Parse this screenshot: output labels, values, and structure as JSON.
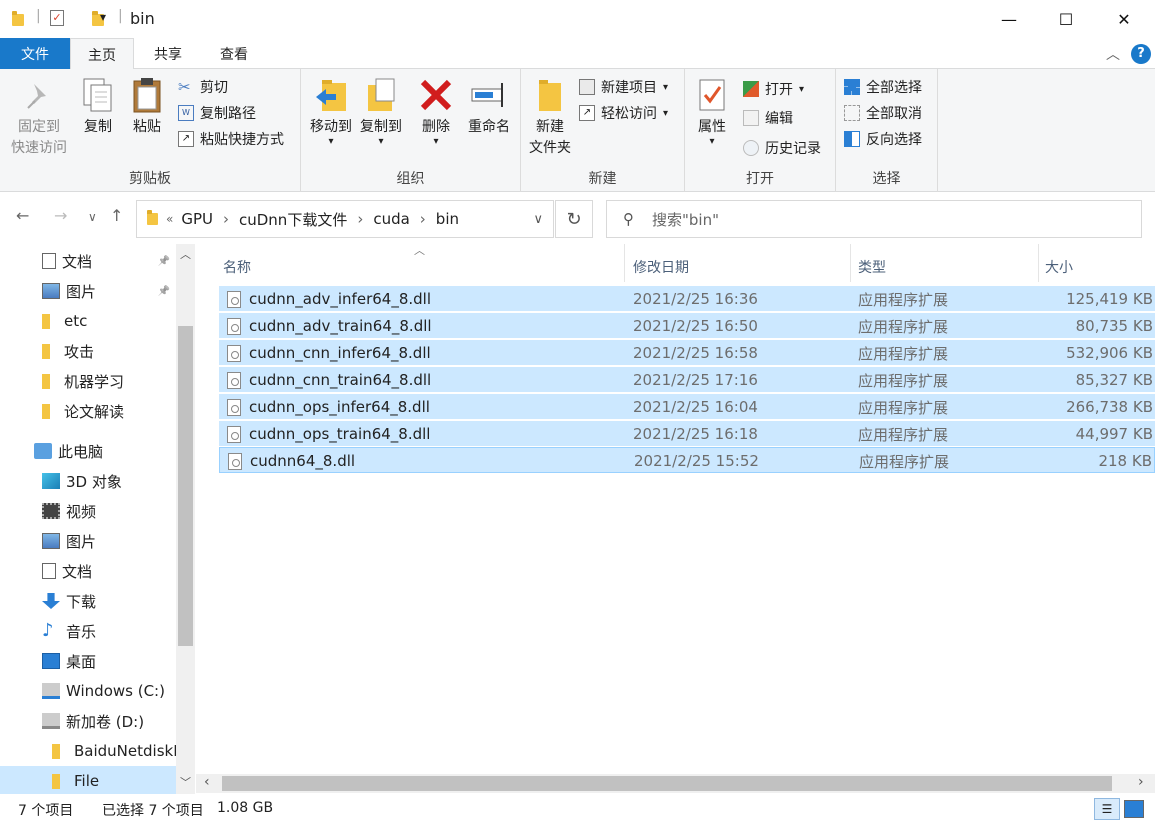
{
  "window": {
    "title": "bin",
    "controls": {
      "minimize": "—",
      "maximize": "☐",
      "close": "✕"
    }
  },
  "ribbon_tabs": {
    "file": "文件",
    "home": "主页",
    "share": "共享",
    "view": "查看"
  },
  "ribbon": {
    "clipboard": {
      "label": "剪贴板",
      "pin_line1": "固定到",
      "pin_line2": "快速访问",
      "copy": "复制",
      "paste": "粘贴",
      "cut": "剪切",
      "copy_path": "复制路径",
      "paste_shortcut": "粘贴快捷方式"
    },
    "organize": {
      "label": "组织",
      "move_to": "移动到",
      "copy_to": "复制到",
      "delete": "删除",
      "rename": "重命名"
    },
    "new": {
      "label": "新建",
      "new_folder_line1": "新建",
      "new_folder_line2": "文件夹",
      "new_item": "新建项目",
      "easy_access": "轻松访问"
    },
    "open": {
      "label": "打开",
      "properties": "属性",
      "open": "打开",
      "edit": "编辑",
      "history": "历史记录"
    },
    "select": {
      "label": "选择",
      "select_all": "全部选择",
      "select_none": "全部取消",
      "invert": "反向选择"
    }
  },
  "address": {
    "breadcrumb": [
      "GPU",
      "cuDnn下载文件",
      "cuda",
      "bin"
    ],
    "search_placeholder": "搜索\"bin\""
  },
  "nav_pane": {
    "items": [
      {
        "label": "文档",
        "icon": "documents-icon"
      },
      {
        "label": "图片",
        "icon": "pictures-icon"
      },
      {
        "label": "etc",
        "icon": "folder-icon"
      },
      {
        "label": "攻击",
        "icon": "folder-icon"
      },
      {
        "label": "机器学习",
        "icon": "folder-icon"
      },
      {
        "label": "论文解读",
        "icon": "folder-icon"
      },
      {
        "label": "此电脑",
        "icon": "this-pc-icon"
      },
      {
        "label": "3D 对象",
        "icon": "3d-objects-icon"
      },
      {
        "label": "视频",
        "icon": "videos-icon"
      },
      {
        "label": "图片",
        "icon": "pictures-icon"
      },
      {
        "label": "文档",
        "icon": "documents-icon"
      },
      {
        "label": "下载",
        "icon": "downloads-icon"
      },
      {
        "label": "音乐",
        "icon": "music-icon"
      },
      {
        "label": "桌面",
        "icon": "desktop-icon"
      },
      {
        "label": "Windows (C:)",
        "icon": "windows-drive-icon"
      },
      {
        "label": "新加卷 (D:)",
        "icon": "drive-icon"
      },
      {
        "label": "BaiduNetdiskI",
        "icon": "folder-icon"
      },
      {
        "label": "File",
        "icon": "folder-icon"
      }
    ]
  },
  "columns": {
    "name": "名称",
    "date": "修改日期",
    "type": "类型",
    "size": "大小"
  },
  "files": [
    {
      "name": "cudnn_adv_infer64_8.dll",
      "date": "2021/2/25 16:36",
      "type": "应用程序扩展",
      "size": "125,419 KB"
    },
    {
      "name": "cudnn_adv_train64_8.dll",
      "date": "2021/2/25 16:50",
      "type": "应用程序扩展",
      "size": "80,735 KB"
    },
    {
      "name": "cudnn_cnn_infer64_8.dll",
      "date": "2021/2/25 16:58",
      "type": "应用程序扩展",
      "size": "532,906 KB"
    },
    {
      "name": "cudnn_cnn_train64_8.dll",
      "date": "2021/2/25 17:16",
      "type": "应用程序扩展",
      "size": "85,327 KB"
    },
    {
      "name": "cudnn_ops_infer64_8.dll",
      "date": "2021/2/25 16:04",
      "type": "应用程序扩展",
      "size": "266,738 KB"
    },
    {
      "name": "cudnn_ops_train64_8.dll",
      "date": "2021/2/25 16:18",
      "type": "应用程序扩展",
      "size": "44,997 KB"
    },
    {
      "name": "cudnn64_8.dll",
      "date": "2021/2/25 15:52",
      "type": "应用程序扩展",
      "size": "218 KB"
    }
  ],
  "status": {
    "count": "7 个项目",
    "selected": "已选择 7 个项目",
    "selected_size": "1.08 GB"
  },
  "colors": {
    "accent": "#1979ca",
    "selection": "#cce8ff",
    "ribbon_bg": "#f5f6f7"
  }
}
